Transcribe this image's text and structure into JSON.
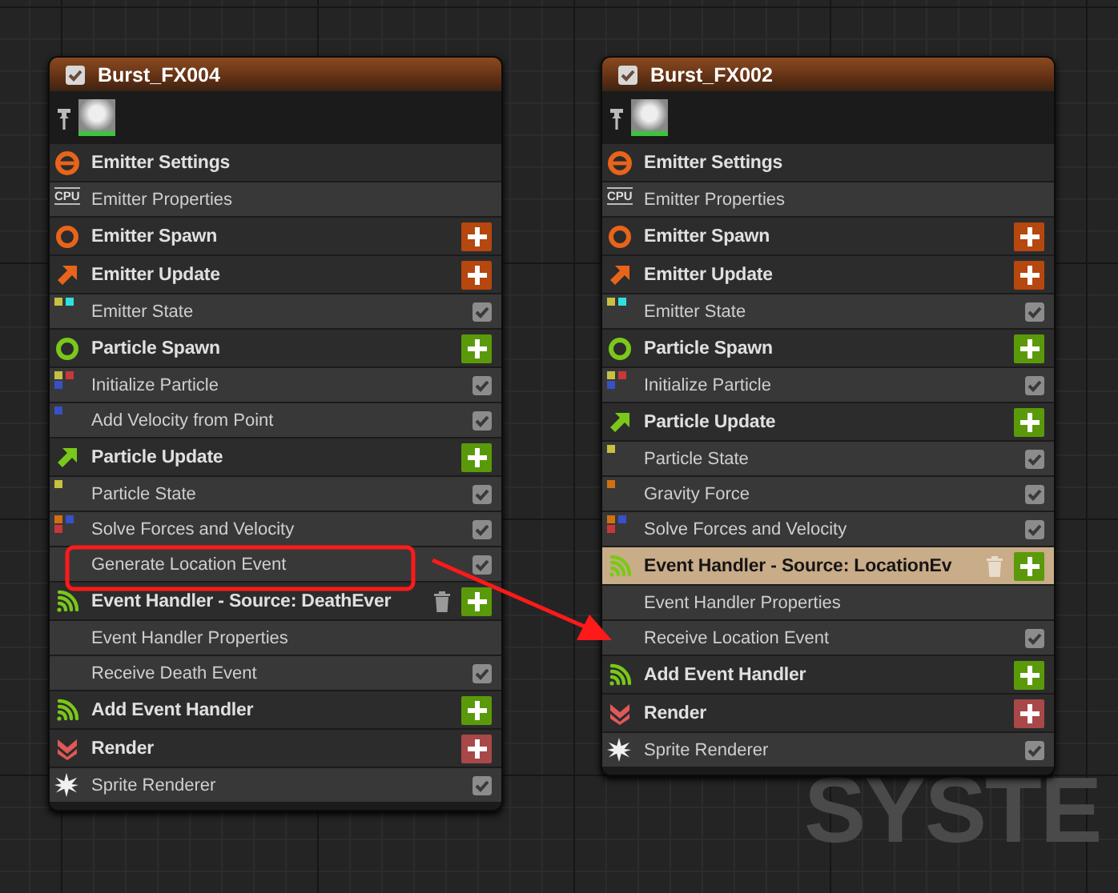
{
  "emitters": [
    {
      "title": "Burst_FX004",
      "enabled": true,
      "rows": [
        {
          "kind": "settings_header",
          "label": "Emitter Settings",
          "color": "#e8641a",
          "add_button": false,
          "delete_button": false,
          "selected": false
        },
        {
          "kind": "cpu_module",
          "label": "Emitter Properties",
          "icon_text": "CPU",
          "selected": false
        },
        {
          "kind": "spawn_header",
          "label": "Emitter Spawn",
          "color": "#e8641a",
          "add_button": true,
          "delete_button": false,
          "selected": false
        },
        {
          "kind": "update_header",
          "label": "Emitter Update",
          "color": "#e8641a",
          "add_button": true,
          "delete_button": false,
          "selected": false
        },
        {
          "kind": "module",
          "label": "Emitter State",
          "dots": [
            {
              "color": "#c8c040"
            },
            {
              "color": "#30e0e0"
            }
          ],
          "checked": true,
          "selected": false
        },
        {
          "kind": "spawn_header",
          "label": "Particle Spawn",
          "color": "#7ac81a",
          "add_button": true,
          "delete_button": false,
          "selected": false
        },
        {
          "kind": "module",
          "label": "Initialize Particle",
          "dots": [
            {
              "color": "#c8c040"
            },
            {
              "color": "#c83838"
            },
            {
              "color": "#3850c8"
            }
          ],
          "checked": true,
          "selected": false
        },
        {
          "kind": "module",
          "label": "Add Velocity from Point",
          "dots": [
            {
              "color": "#3850c8"
            }
          ],
          "checked": true,
          "selected": false
        },
        {
          "kind": "update_header",
          "label": "Particle Update",
          "color": "#7ac81a",
          "add_button": true,
          "delete_button": false,
          "selected": false
        },
        {
          "kind": "module",
          "label": "Particle State",
          "dots": [
            {
              "color": "#c8c040"
            }
          ],
          "checked": true,
          "selected": false
        },
        {
          "kind": "module",
          "label": "Solve Forces and Velocity",
          "dots": [
            {
              "color": "#d07010"
            },
            {
              "color": "#3850c8"
            },
            {
              "color": "#c83838"
            }
          ],
          "checked": true,
          "selected": false
        },
        {
          "kind": "module",
          "label": "Generate Location Event",
          "checked": true,
          "selected": false
        },
        {
          "kind": "event_header",
          "label": "Event Handler - Source: DeathEver",
          "color": "#7ac81a",
          "add_button": true,
          "delete_button": true,
          "selected": false
        },
        {
          "kind": "plain_module",
          "label": "Event Handler Properties",
          "selected": false
        },
        {
          "kind": "module",
          "label": "Receive Death Event",
          "checked": true,
          "selected": false
        },
        {
          "kind": "event_header",
          "label": "Add Event Handler",
          "color": "#7ac81a",
          "add_button": true,
          "delete_button": false,
          "selected": false
        },
        {
          "kind": "render_header",
          "label": "Render",
          "color": "#e05858",
          "add_button": true,
          "delete_button": false,
          "selected": false
        },
        {
          "kind": "renderer_module",
          "label": "Sprite Renderer",
          "checked": true,
          "selected": false
        }
      ]
    },
    {
      "title": "Burst_FX002",
      "enabled": true,
      "rows": [
        {
          "kind": "settings_header",
          "label": "Emitter Settings",
          "color": "#e8641a",
          "add_button": false,
          "delete_button": false,
          "selected": false
        },
        {
          "kind": "cpu_module",
          "label": "Emitter Properties",
          "icon_text": "CPU",
          "selected": false
        },
        {
          "kind": "spawn_header",
          "label": "Emitter Spawn",
          "color": "#e8641a",
          "add_button": true,
          "delete_button": false,
          "selected": false
        },
        {
          "kind": "update_header",
          "label": "Emitter Update",
          "color": "#e8641a",
          "add_button": true,
          "delete_button": false,
          "selected": false
        },
        {
          "kind": "module",
          "label": "Emitter State",
          "dots": [
            {
              "color": "#c8c040"
            },
            {
              "color": "#30e0e0"
            }
          ],
          "checked": true,
          "selected": false
        },
        {
          "kind": "spawn_header",
          "label": "Particle Spawn",
          "color": "#7ac81a",
          "add_button": true,
          "delete_button": false,
          "selected": false
        },
        {
          "kind": "module",
          "label": "Initialize Particle",
          "dots": [
            {
              "color": "#c8c040"
            },
            {
              "color": "#c83838"
            },
            {
              "color": "#3850c8"
            }
          ],
          "checked": true,
          "selected": false
        },
        {
          "kind": "update_header",
          "label": "Particle Update",
          "color": "#7ac81a",
          "add_button": true,
          "delete_button": false,
          "selected": false
        },
        {
          "kind": "module",
          "label": "Particle State",
          "dots": [
            {
              "color": "#c8c040"
            }
          ],
          "checked": true,
          "selected": false
        },
        {
          "kind": "module",
          "label": "Gravity Force",
          "dots": [
            {
              "color": "#d07010"
            }
          ],
          "checked": true,
          "selected": false
        },
        {
          "kind": "module",
          "label": "Solve Forces and Velocity",
          "dots": [
            {
              "color": "#d07010"
            },
            {
              "color": "#3850c8"
            },
            {
              "color": "#c83838"
            }
          ],
          "checked": true,
          "selected": false
        },
        {
          "kind": "event_header",
          "label": "Event Handler - Source: LocationEv",
          "color": "#7ac81a",
          "add_button": true,
          "delete_button": true,
          "selected": true
        },
        {
          "kind": "plain_module",
          "label": "Event Handler Properties",
          "selected": false
        },
        {
          "kind": "module",
          "label": "Receive Location Event",
          "checked": true,
          "selected": false
        },
        {
          "kind": "event_header",
          "label": "Add Event Handler",
          "color": "#7ac81a",
          "add_button": true,
          "delete_button": false,
          "selected": false
        },
        {
          "kind": "render_header",
          "label": "Render",
          "color": "#e05858",
          "add_button": true,
          "delete_button": false,
          "selected": false
        },
        {
          "kind": "renderer_module",
          "label": "Sprite Renderer",
          "checked": true,
          "selected": false
        }
      ]
    }
  ],
  "background_label": "SYSTE"
}
